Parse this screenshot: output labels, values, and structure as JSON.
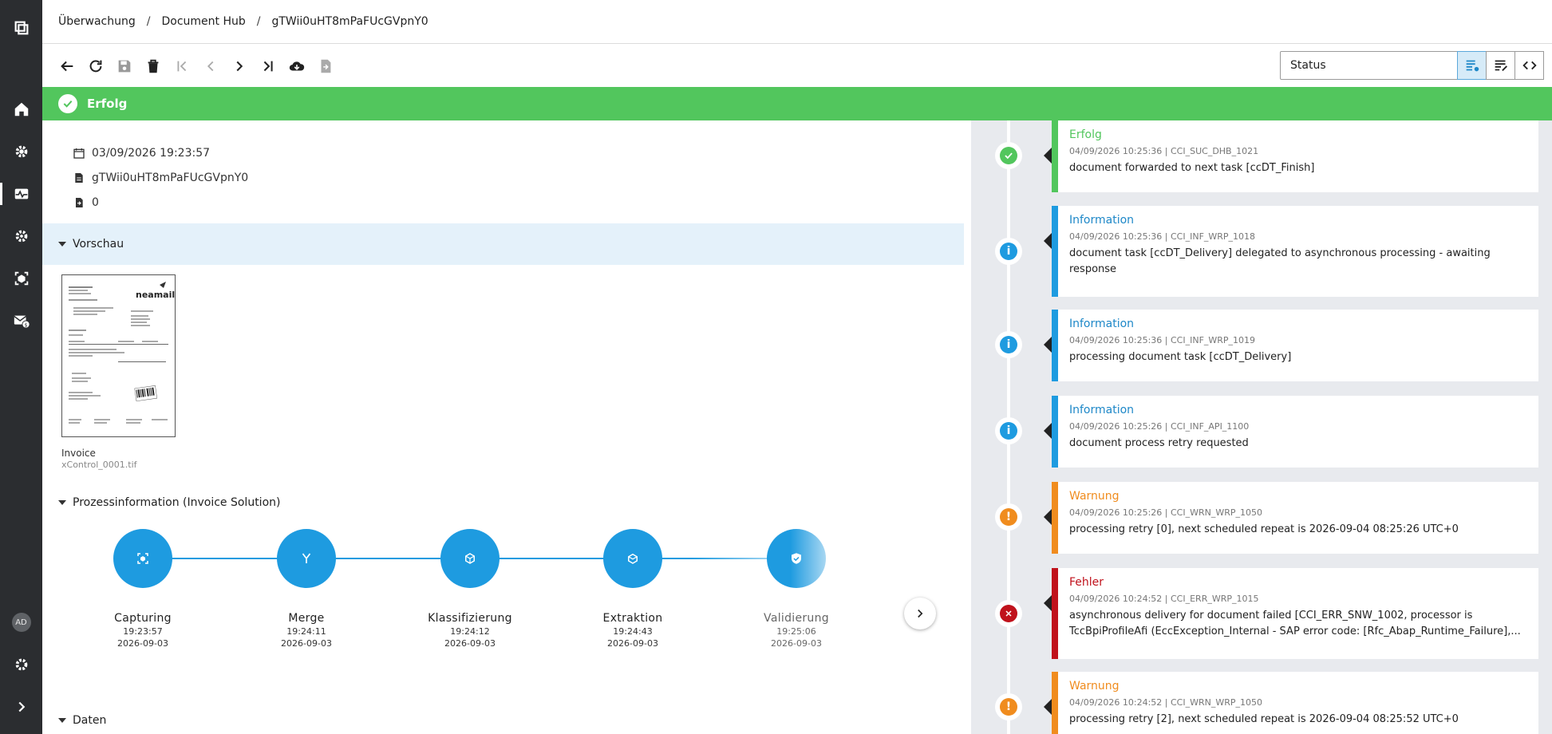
{
  "nav": {
    "avatar_initials": "AD"
  },
  "breadcrumb": {
    "items": [
      "Überwachung",
      "Document Hub",
      "gTWii0uHT8mPaFUcGVpnY0"
    ],
    "separator": "/"
  },
  "toolbar": {
    "status_select": {
      "value": "Status"
    }
  },
  "banner": {
    "text": "Erfolg",
    "color": "#52c65d"
  },
  "document": {
    "date": "03/09/2026 19:23:57",
    "id": "gTWii0uHT8mPaFUcGVpnY0",
    "count": "0"
  },
  "sections": {
    "preview": "Vorschau",
    "process": "Prozessinformation (Invoice Solution)",
    "data": "Daten"
  },
  "preview": {
    "title": "Invoice",
    "file": "xControl_0001.tif",
    "thumb_brand": "neamail"
  },
  "process_steps": [
    {
      "name": "Capturing",
      "time": "19:23:57",
      "date": "2026-09-03",
      "icon": "capture-icon"
    },
    {
      "name": "Merge",
      "time": "19:24:11",
      "date": "2026-09-03",
      "icon": "merge-icon"
    },
    {
      "name": "Klassifizierung",
      "time": "19:24:12",
      "date": "2026-09-03",
      "icon": "classify-icon"
    },
    {
      "name": "Extraktion",
      "time": "19:24:43",
      "date": "2026-09-03",
      "icon": "extract-icon"
    },
    {
      "name": "Validierung",
      "time": "19:25:06",
      "date": "2026-09-03",
      "icon": "shield-check-icon"
    }
  ],
  "timeline": [
    {
      "type": "success",
      "title": "Erfolg",
      "meta": "04/09/2026 10:25:36 | CCI_SUC_DHB_1021",
      "message": "document forwarded to next task [ccDT_Finish]",
      "color": "#52c65d"
    },
    {
      "type": "info",
      "title": "Information",
      "meta": "04/09/2026 10:25:36 | CCI_INF_WRP_1018",
      "message": "document task [ccDT_Delivery] delegated to asynchronous processing - awaiting response",
      "color": "#1e9be0"
    },
    {
      "type": "info",
      "title": "Information",
      "meta": "04/09/2026 10:25:36 | CCI_INF_WRP_1019",
      "message": "processing document task [ccDT_Delivery]",
      "color": "#1e9be0"
    },
    {
      "type": "info",
      "title": "Information",
      "meta": "04/09/2026 10:25:26 | CCI_INF_API_1100",
      "message": "document process retry requested",
      "color": "#1e9be0"
    },
    {
      "type": "warning",
      "title": "Warnung",
      "meta": "04/09/2026 10:25:26 | CCI_WRN_WRP_1050",
      "message": "processing retry [0], next scheduled repeat is 2026-09-04 08:25:26 UTC+0",
      "color": "#f08c1e"
    },
    {
      "type": "error",
      "title": "Fehler",
      "meta": "04/09/2026 10:24:52 | CCI_ERR_WRP_1015",
      "message": "asynchronous delivery for document failed [CCI_ERR_SNW_1002, processor is",
      "message2": "TccBpiProfileAfi (EccException_Internal - SAP error code: [Rfc_Abap_Runtime_Failure],...",
      "color": "#c0121c"
    },
    {
      "type": "warning",
      "title": "Warnung",
      "meta": "04/09/2026 10:24:52 | CCI_WRN_WRP_1050",
      "message": "processing retry [2], next scheduled repeat is 2026-09-04 08:25:52 UTC+0",
      "color": "#f08c1e"
    }
  ]
}
